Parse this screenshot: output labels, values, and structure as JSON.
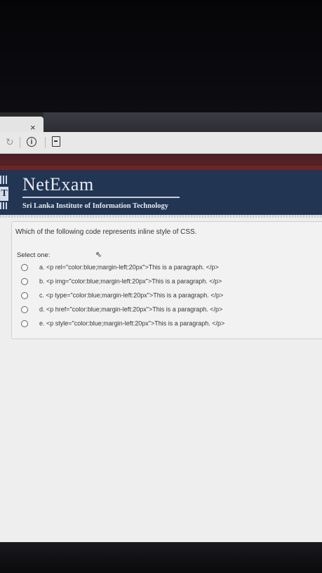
{
  "browser": {
    "tab_close": "×",
    "reload_icon": "↻",
    "info_icon": "i"
  },
  "header": {
    "brand": "NetExam",
    "subtitle": "Sri Lanka Institute of Information Technology",
    "logo_letter": "T"
  },
  "quiz": {
    "question": "Which of the following code represents inline style of CSS.",
    "select_label": "Select one:",
    "options": [
      {
        "label": "a. <p rel=\"color:blue;margin-left:20px\">This is a paragraph. </p>",
        "selected": false
      },
      {
        "label": "b. <p img=\"color:blue;margin-left:20px\">This is a paragraph. </p>",
        "selected": false
      },
      {
        "label": "c. <p type=\"color:blue;margin-left:20px\">This is a paragraph. </p>",
        "selected": false
      },
      {
        "label": "d. <p href=\"color:blue;margin-left:20px\">This is a paragraph. </p>",
        "selected": false
      },
      {
        "label": "e. <p style=\"color:blue;margin-left:20px\">This is a paragraph. </p>",
        "selected": false
      }
    ]
  },
  "colors": {
    "header_bg": "#223654",
    "maroon_bar": "#5a2427"
  }
}
